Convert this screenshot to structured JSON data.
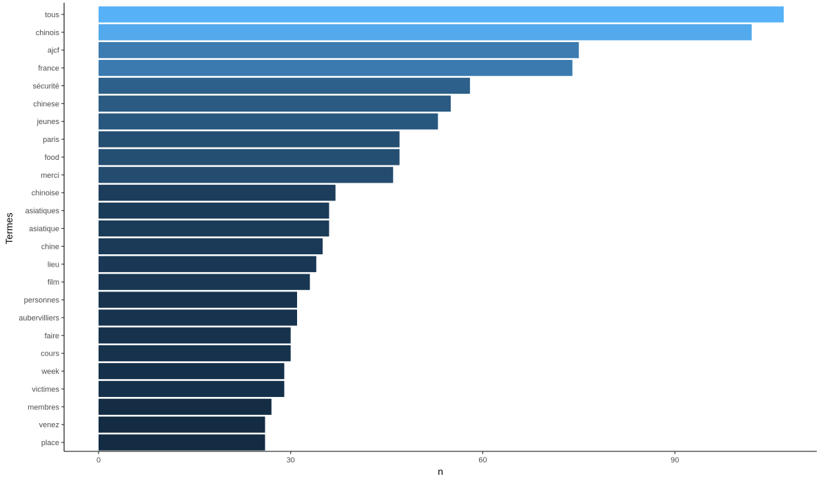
{
  "chart_data": {
    "type": "bar",
    "orientation": "horizontal",
    "title": "",
    "xlabel": "n",
    "ylabel": "Termes",
    "categories": [
      "tous",
      "chinois",
      "ajcf",
      "france",
      "sécurité",
      "chinese",
      "jeunes",
      "paris",
      "food",
      "merci",
      "chinoise",
      "asiatiques",
      "asiatique",
      "chine",
      "lieu",
      "film",
      "personnes",
      "aubervilliers",
      "faire",
      "cours",
      "week",
      "victimes",
      "membres",
      "venez",
      "place"
    ],
    "values": [
      107,
      102,
      75,
      74,
      58,
      55,
      53,
      47,
      47,
      46,
      37,
      36,
      36,
      35,
      34,
      33,
      31,
      31,
      30,
      30,
      29,
      29,
      27,
      26,
      26
    ],
    "xlim": [
      -5.3,
      112
    ],
    "x_ticks": [
      0,
      30,
      60,
      90
    ],
    "x_tick_labels": [
      "0",
      "30",
      "60",
      "90"
    ],
    "grid": false,
    "legend": "none",
    "fill_gradient": {
      "low": "#132B43",
      "high": "#56B1F7",
      "domain": [
        26,
        107
      ]
    }
  }
}
